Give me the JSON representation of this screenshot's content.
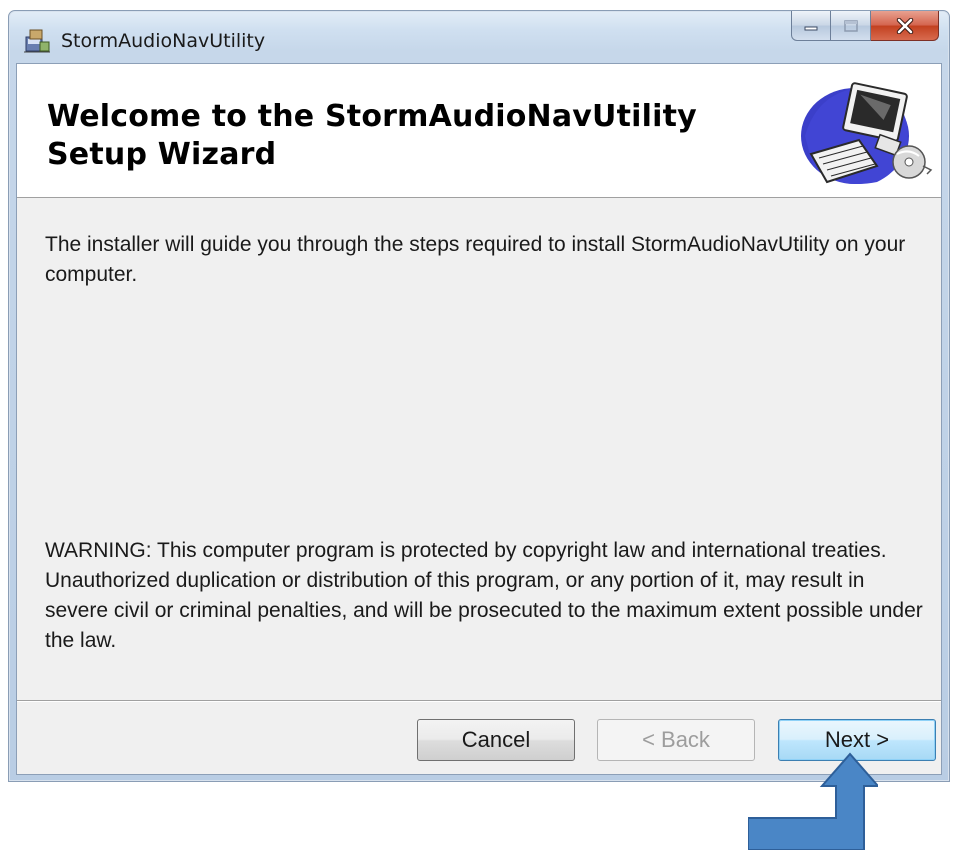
{
  "window": {
    "title": "StormAudioNavUtility"
  },
  "banner": {
    "title": "Welcome to the StormAudioNavUtility Setup Wizard",
    "graphic_icon": "computer-setup-icon"
  },
  "body": {
    "intro": "The installer will guide you through the steps required to install StormAudioNavUtility on your computer.",
    "warning": "WARNING: This computer program is protected by copyright law and international treaties. Unauthorized duplication or distribution of this program, or any portion of it, may result in severe civil or criminal penalties, and will be prosecuted to the maximum extent possible under the law."
  },
  "buttons": {
    "cancel": "Cancel",
    "back": "< Back",
    "next": "Next >"
  },
  "colors": {
    "arrow": "#4a86c6",
    "close_button": "#c7432a",
    "next_border": "#3c7fb1"
  }
}
